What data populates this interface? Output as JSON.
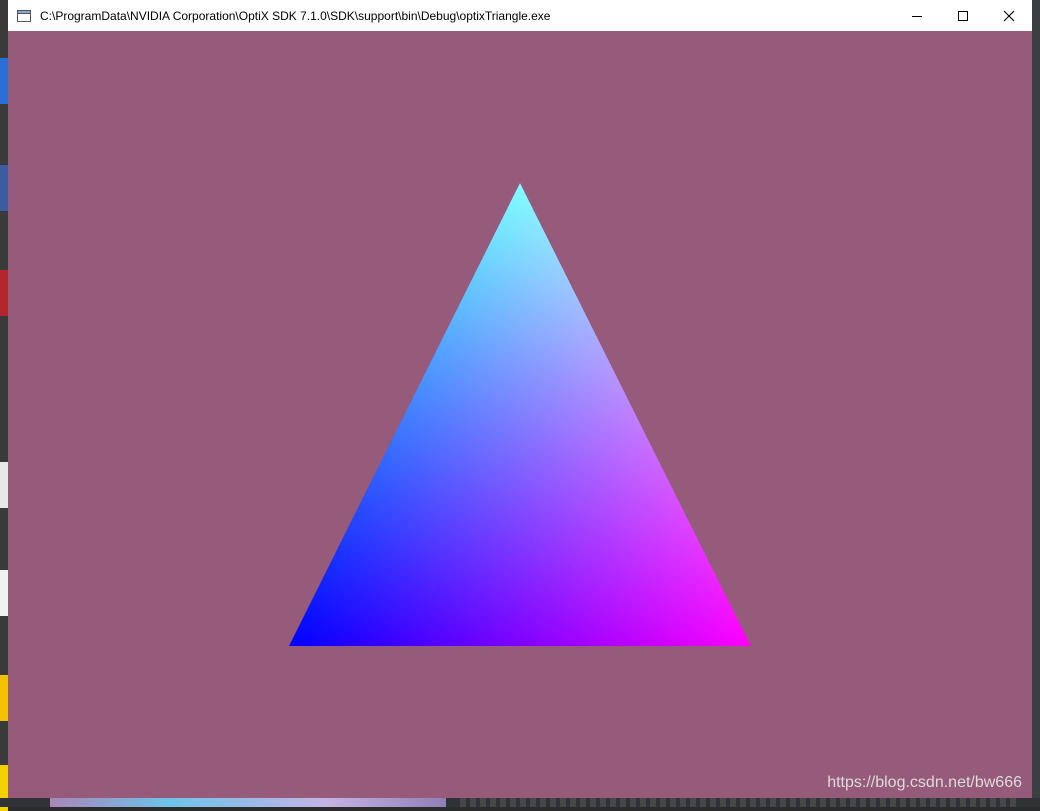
{
  "window": {
    "title": "C:\\ProgramData\\NVIDIA Corporation\\OptiX SDK 7.1.0\\SDK\\support\\bin\\Debug\\optixTriangle.exe",
    "background_color": "#965a7a"
  },
  "controls": {
    "minimize_icon": "minimize-icon",
    "maximize_icon": "maximize-icon",
    "close_icon": "close-icon"
  },
  "triangle": {
    "top_color": "#00ffff",
    "bottom_left_color": "#0000ff",
    "bottom_right_color": "#ff00ff"
  },
  "watermark": {
    "text": "https://blog.csdn.net/bw666"
  }
}
